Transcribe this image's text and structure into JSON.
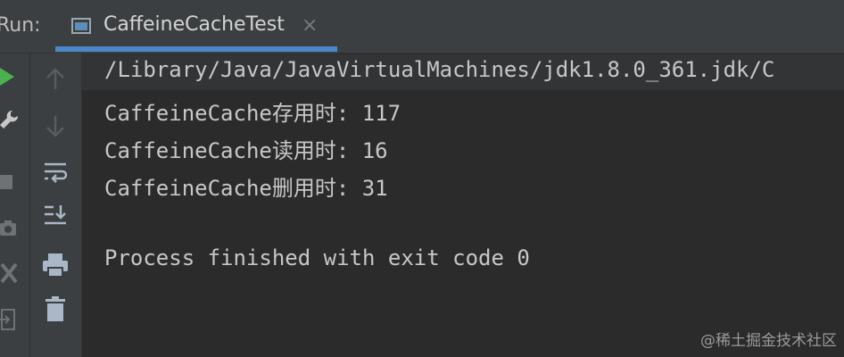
{
  "run_panel": {
    "label": "Run:",
    "tab": {
      "title": "CaffeineCacheTest",
      "close_glyph": "×",
      "icon": "console-window-icon"
    }
  },
  "left_strip_icons": [
    "run-icon",
    "wrench-icon",
    "stop-icon",
    "camera-icon",
    "tools-icon",
    "exit-icon"
  ],
  "toolbar_icons": [
    "up-arrow-icon",
    "down-arrow-icon",
    "soft-wrap-icon",
    "scroll-to-end-icon",
    "print-icon",
    "trash-icon"
  ],
  "console": {
    "lines": [
      "/Library/Java/JavaVirtualMachines/jdk1.8.0_361.jdk/C",
      "CaffeineCache存用时: 117",
      "CaffeineCache读用时: 16",
      "CaffeineCache删用时: 31",
      "",
      "Process finished with exit code 0"
    ]
  },
  "watermark": "@稀土掘金技术社区",
  "colors": {
    "run_green": "#4caf50",
    "tab_underline": "#4a88c7",
    "console_text": "#c7c7c7",
    "console_bg": "#2b2b2b",
    "panel_bg": "#3c3f41"
  }
}
